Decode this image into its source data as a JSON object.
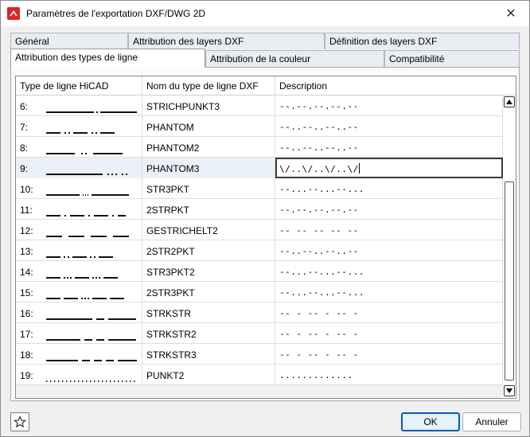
{
  "window": {
    "title": "Paramètres de l'exportation DXF/DWG 2D",
    "close_glyph": "✕",
    "app_icon": "hicad-logo-icon"
  },
  "tabs": {
    "row_back": [
      "Général",
      "Attribution des layers DXF",
      "Définition des layers DXF"
    ],
    "row_front": [
      "Attribution des types de ligne",
      "Attribution de la couleur",
      "Compatibilité"
    ],
    "active": "Attribution des types de ligne"
  },
  "table": {
    "columns": [
      "Type de ligne HiCAD",
      "Nom du type de ligne DXF",
      "Description"
    ],
    "rows": [
      {
        "num": "6:",
        "pattern": "strichpunkt3",
        "dxf_name": "STRICHPUNKT3",
        "description": "--.--.--.--.--"
      },
      {
        "num": "7:",
        "pattern": "phantom",
        "dxf_name": "PHANTOM",
        "description": "--..--..--..--"
      },
      {
        "num": "8:",
        "pattern": "phantom2",
        "dxf_name": "PHANTOM2",
        "description": "--..--..--..--"
      },
      {
        "num": "9:",
        "pattern": "phantom3",
        "dxf_name": "PHANTOM3",
        "description": "\\/..\\/..\\/..\\/"
      },
      {
        "num": "10:",
        "pattern": "str3pkt",
        "dxf_name": "STR3PKT",
        "description": "--...--...--..."
      },
      {
        "num": "11:",
        "pattern": "2strpkt",
        "dxf_name": "2STRPKT",
        "description": "--.--.--.--.--"
      },
      {
        "num": "12:",
        "pattern": "gestrichelt2",
        "dxf_name": "GESTRICHELT2",
        "description": "-- -- -- -- --"
      },
      {
        "num": "13:",
        "pattern": "2str2pkt",
        "dxf_name": "2STR2PKT",
        "description": "--..--..--..--"
      },
      {
        "num": "14:",
        "pattern": "str3pkt2",
        "dxf_name": "STR3PKT2",
        "description": "--...--...--..."
      },
      {
        "num": "15:",
        "pattern": "2str3pkt",
        "dxf_name": "2STR3PKT",
        "description": "--...--...--..."
      },
      {
        "num": "16:",
        "pattern": "strkstr",
        "dxf_name": "STRKSTR",
        "description": "-- - -- - -- -"
      },
      {
        "num": "17:",
        "pattern": "strkstr2",
        "dxf_name": "STRKSTR2",
        "description": "-- - -- - -- -"
      },
      {
        "num": "18:",
        "pattern": "strkstr3",
        "dxf_name": "STRKSTR3",
        "description": "-- - -- - -- -"
      },
      {
        "num": "19:",
        "pattern": "punkt2",
        "dxf_name": "PUNKT2",
        "description": "............."
      }
    ],
    "selected_row": "9:"
  },
  "footer": {
    "favorite_icon": "star-icon",
    "ok_label": "OK",
    "cancel_label": "Annuler"
  },
  "colors": {
    "accent": "#005fb8",
    "selected_row_bg": "#eaf1fb",
    "tab_bg": "#e9ecf3"
  }
}
